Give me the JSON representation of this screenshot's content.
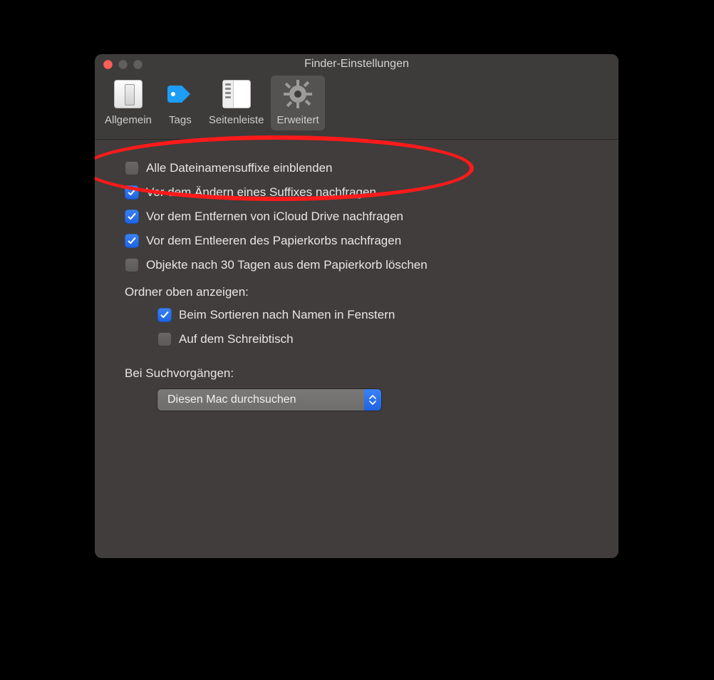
{
  "window": {
    "title": "Finder-Einstellungen"
  },
  "toolbar": {
    "tabs": [
      {
        "label": "Allgemein"
      },
      {
        "label": "Tags"
      },
      {
        "label": "Seitenleiste"
      },
      {
        "label": "Erweitert"
      }
    ],
    "selected_index": 3
  },
  "options": {
    "show_extensions": {
      "checked": false,
      "label": "Alle Dateinamensuffixe einblenden"
    },
    "warn_change_ext": {
      "checked": true,
      "label": "Vor dem Ändern eines Suffixes nachfragen"
    },
    "warn_icloud_remove": {
      "checked": true,
      "label": "Vor dem Entfernen von iCloud Drive nachfragen"
    },
    "warn_empty_trash": {
      "checked": true,
      "label": "Vor dem Entleeren des Papierkorbs nachfragen"
    },
    "auto_empty_trash": {
      "checked": false,
      "label": "Objekte nach 30 Tagen aus dem Papierkorb löschen"
    }
  },
  "folders_on_top": {
    "heading": "Ordner oben anzeigen:",
    "in_windows": {
      "checked": true,
      "label": "Beim Sortieren nach Namen in Fenstern"
    },
    "on_desktop": {
      "checked": false,
      "label": "Auf dem Schreibtisch"
    }
  },
  "search": {
    "heading": "Bei Suchvorgängen:",
    "selected": "Diesen Mac durchsuchen"
  },
  "annotation": {
    "target": "options.show_extensions",
    "shape": "ellipse",
    "color": "#ff1a1a"
  }
}
